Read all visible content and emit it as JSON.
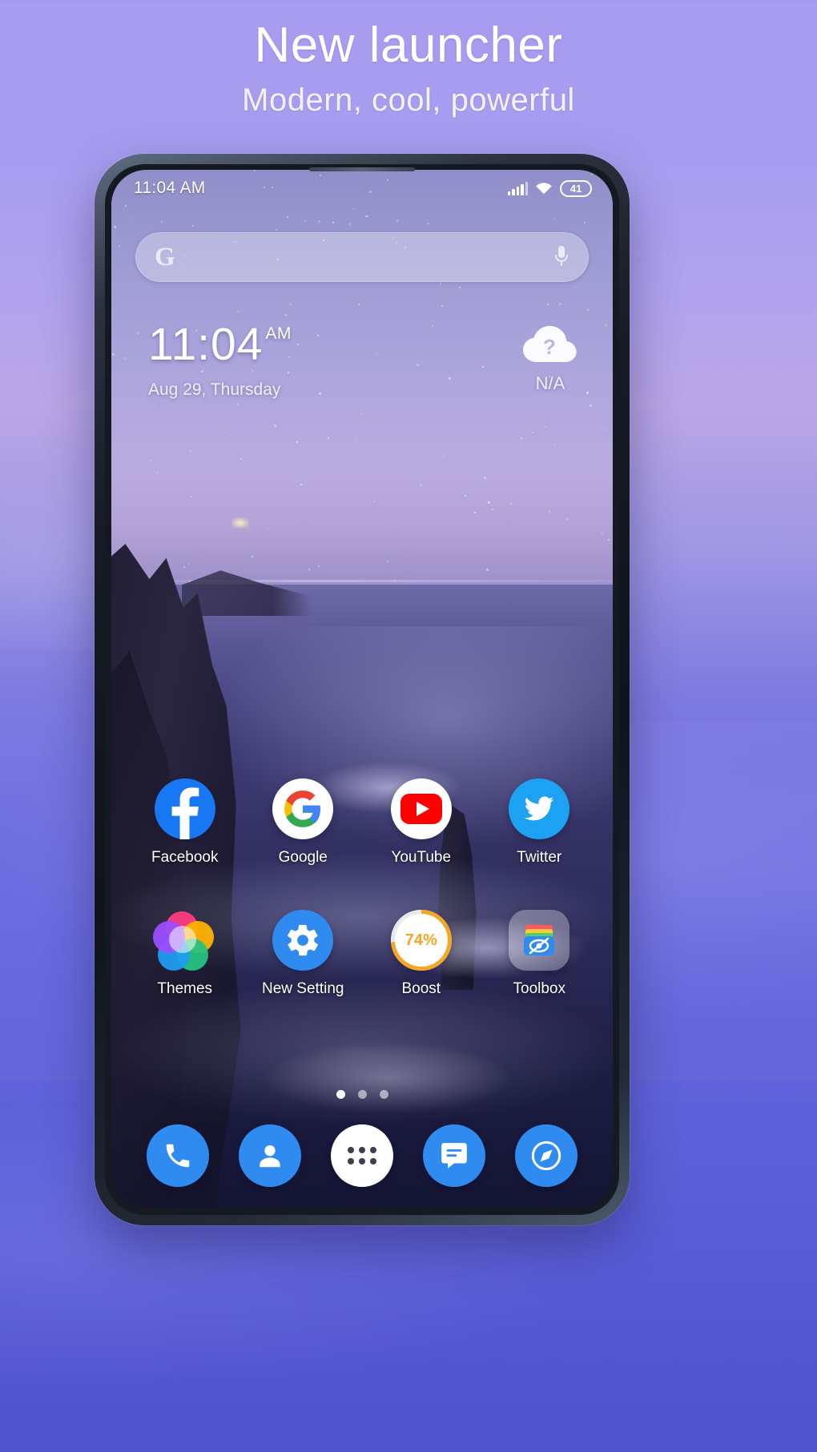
{
  "promo": {
    "title": "New launcher",
    "subtitle": "Modern, cool, powerful"
  },
  "phone": {
    "status_bar": {
      "time": "11:04 AM",
      "signal_icon": "signal-bars-icon",
      "wifi_icon": "wifi-icon",
      "battery_level": "41"
    },
    "search": {
      "google_logo": "G",
      "mic_icon": "microphone-icon",
      "placeholder": ""
    },
    "clock_widget": {
      "time": "11:04",
      "ampm": "AM",
      "date": "Aug 29, Thursday"
    },
    "weather_widget": {
      "icon": "cloud-question-icon",
      "glyph": "?",
      "temperature": "N/A"
    },
    "app_rows": [
      [
        {
          "label": "Facebook",
          "icon": "facebook-icon",
          "color": "#1877f2"
        },
        {
          "label": "Google",
          "icon": "google-icon",
          "color": "#ffffff"
        },
        {
          "label": "YouTube",
          "icon": "youtube-icon",
          "color": "#ff0000"
        },
        {
          "label": "Twitter",
          "icon": "twitter-icon",
          "color": "#1da1f2"
        }
      ],
      [
        {
          "label": "Themes",
          "icon": "themes-flower-icon",
          "color": "#e91e63"
        },
        {
          "label": "New Setting",
          "icon": "gear-icon",
          "color": "#2f8bf0"
        },
        {
          "label": "Boost",
          "icon": "boost-ring-icon",
          "color": "#f5a623",
          "value": "74%"
        },
        {
          "label": "Toolbox",
          "icon": "toolbox-icon",
          "color": "#2f8bf0"
        }
      ]
    ],
    "page_indicator": {
      "count": 3,
      "active": 0
    },
    "dock": [
      {
        "label": "Phone",
        "icon": "phone-icon"
      },
      {
        "label": "Contacts",
        "icon": "contacts-icon"
      },
      {
        "label": "App drawer",
        "icon": "app-drawer-icon"
      },
      {
        "label": "Messages",
        "icon": "message-icon"
      },
      {
        "label": "Browser",
        "icon": "browser-compass-icon"
      }
    ]
  }
}
